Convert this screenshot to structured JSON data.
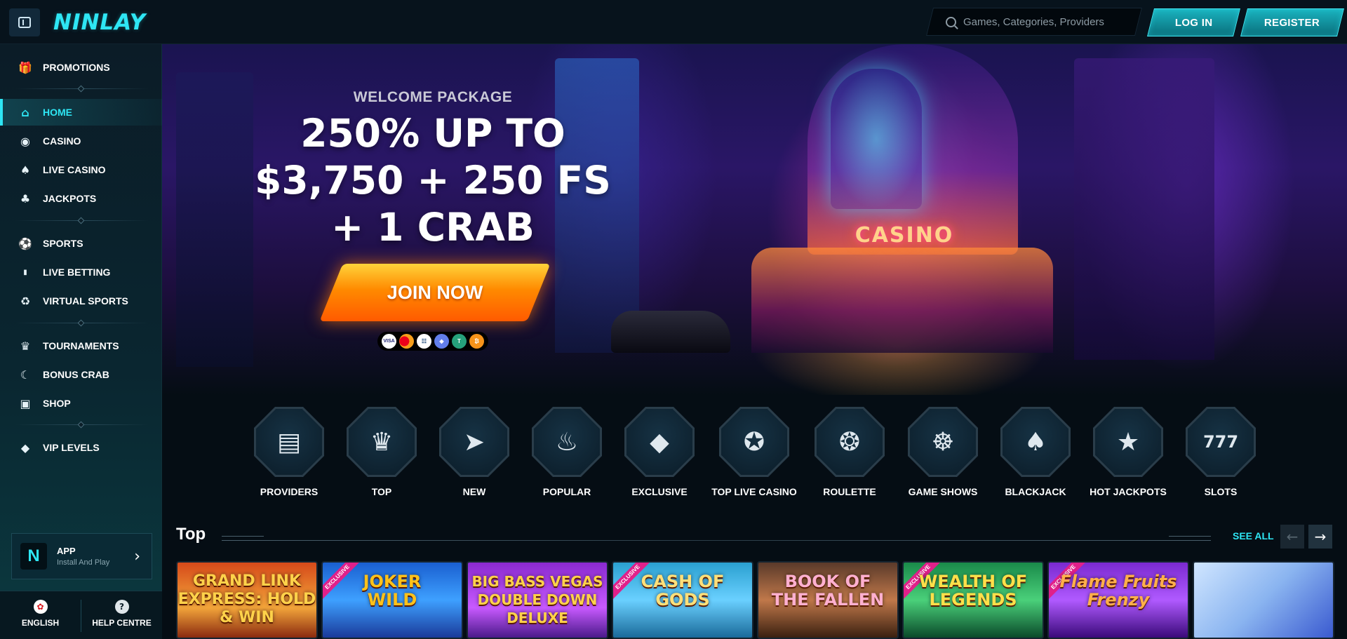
{
  "header": {
    "logo": "NINLAY",
    "search_placeholder": "Games, Categories, Providers",
    "login_label": "LOG IN",
    "register_label": "REGISTER"
  },
  "sidebar": {
    "items": [
      {
        "label": "PROMOTIONS",
        "icon": "gift-icon"
      },
      {
        "label": "HOME",
        "icon": "home-icon",
        "active": true
      },
      {
        "label": "CASINO",
        "icon": "casino-chip-icon"
      },
      {
        "label": "LIVE CASINO",
        "icon": "live-cards-icon"
      },
      {
        "label": "JACKPOTS",
        "icon": "clover-icon"
      },
      {
        "label": "SPORTS",
        "icon": "soccer-ball-icon"
      },
      {
        "label": "LIVE BETTING",
        "icon": "live-badge-icon"
      },
      {
        "label": "VIRTUAL SPORTS",
        "icon": "gamepad-icon"
      },
      {
        "label": "TOURNAMENTS",
        "icon": "trophy-icon"
      },
      {
        "label": "BONUS CRAB",
        "icon": "crab-icon"
      },
      {
        "label": "SHOP",
        "icon": "shopping-bag-icon"
      },
      {
        "label": "VIP LEVELS",
        "icon": "diamond-icon"
      }
    ],
    "app": {
      "title": "APP",
      "subtitle": "Install And Play"
    },
    "footer": {
      "language": "ENGLISH",
      "help": "HELP CENTRE"
    }
  },
  "hero": {
    "kicker": "WELCOME PACKAGE",
    "headline": "250% UP TO\n$3,750 + 250 FS\n+ 1 CRAB",
    "cta": "JOIN NOW",
    "sign": "CASINO",
    "payments": [
      "VISA",
      "MC",
      "BANK",
      "ETH",
      "USDT",
      "BTC"
    ]
  },
  "categories": [
    {
      "label": "PROVIDERS",
      "icon": "book-icon"
    },
    {
      "label": "TOP",
      "icon": "crown-icon"
    },
    {
      "label": "NEW",
      "icon": "rocket-icon"
    },
    {
      "label": "POPULAR",
      "icon": "flame-icon"
    },
    {
      "label": "EXCLUSIVE",
      "icon": "diamond-icon"
    },
    {
      "label": "TOP LIVE CASINO",
      "icon": "award-ribbon-icon"
    },
    {
      "label": "ROULETTE",
      "icon": "roulette-wheel-icon"
    },
    {
      "label": "GAME SHOWS",
      "icon": "wheel-stand-icon"
    },
    {
      "label": "BLACKJACK",
      "icon": "playing-cards-icon"
    },
    {
      "label": "HOT JACKPOTS",
      "icon": "chili-flame-icon"
    },
    {
      "label": "SLOTS",
      "icon": "slot-machine-icon"
    }
  ],
  "top_section": {
    "title": "Top",
    "see_all": "SEE ALL",
    "games": [
      {
        "title": "GRAND LINK\nEXPRESS: HOLD & WIN",
        "exclusive": false
      },
      {
        "title": "JOKER\nWILD",
        "exclusive": true
      },
      {
        "title": "BIG BASS VEGAS\nDOUBLE DOWN DELUXE",
        "exclusive": false
      },
      {
        "title": "CASH OF\nGODS",
        "exclusive": true
      },
      {
        "title": "BOOK OF\nTHE FALLEN",
        "exclusive": false
      },
      {
        "title": "WEALTH OF\nLEGENDS",
        "exclusive": true
      },
      {
        "title": "Flame Fruits\nFrenzy",
        "exclusive": true
      },
      {
        "title": "",
        "exclusive": false
      }
    ],
    "exclusive_label": "EXCLUSIVE"
  }
}
